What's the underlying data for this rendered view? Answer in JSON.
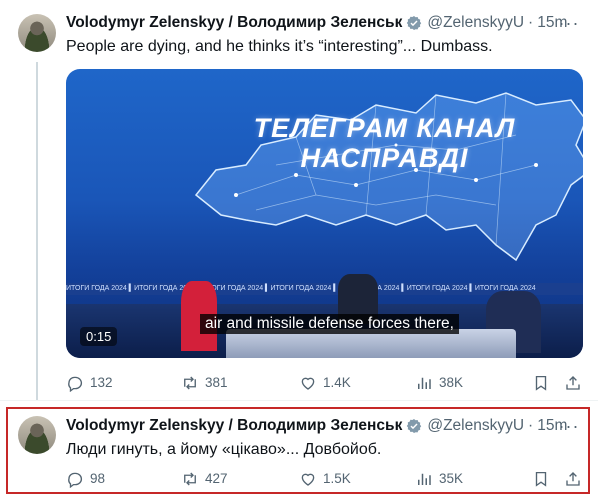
{
  "tweets": [
    {
      "name": "Volodymyr Zelenskyy / Володимир Зеленськ",
      "handle": "@ZelenskyyU",
      "dot": "·",
      "time": "15m",
      "more": "···",
      "text": "People are dying, and he thinks it’s “interesting”... Dumbass.",
      "media": {
        "watermark_line1": "ТЕЛЕГРАМ КАНАЛ",
        "watermark_line2": "НАСПРАВДІ",
        "banner": "ИТОГИ ГОДА 2024 ▍ИТОГИ ГОДА 2024 ▍ИТОГИ ГОДА 2024 ▍ИТОГИ ГОДА 2024 ▍ИТОГИ ГОДА 2024 ▍ИТОГИ ГОДА 2024 ▍ИТОГИ ГОДА 2024",
        "subtitle": "air and missile defense forces there,",
        "timecode": "0:15"
      },
      "stats": {
        "replies": "132",
        "reposts": "381",
        "likes": "1.4K",
        "views": "38K"
      }
    },
    {
      "name": "Volodymyr Zelenskyy / Володимир Зеленськ",
      "handle": "@ZelenskyyU",
      "dot": "·",
      "time": "15m",
      "more": "···",
      "text": "Люди гинуть, а йому «цікаво»... Довбойоб.",
      "stats": {
        "replies": "98",
        "reposts": "427",
        "likes": "1.5K",
        "views": "35K"
      }
    }
  ],
  "colors": {
    "text": "#0f1419",
    "secondary": "#536471",
    "verified": "#829aab",
    "highlight_border": "#c62828"
  }
}
